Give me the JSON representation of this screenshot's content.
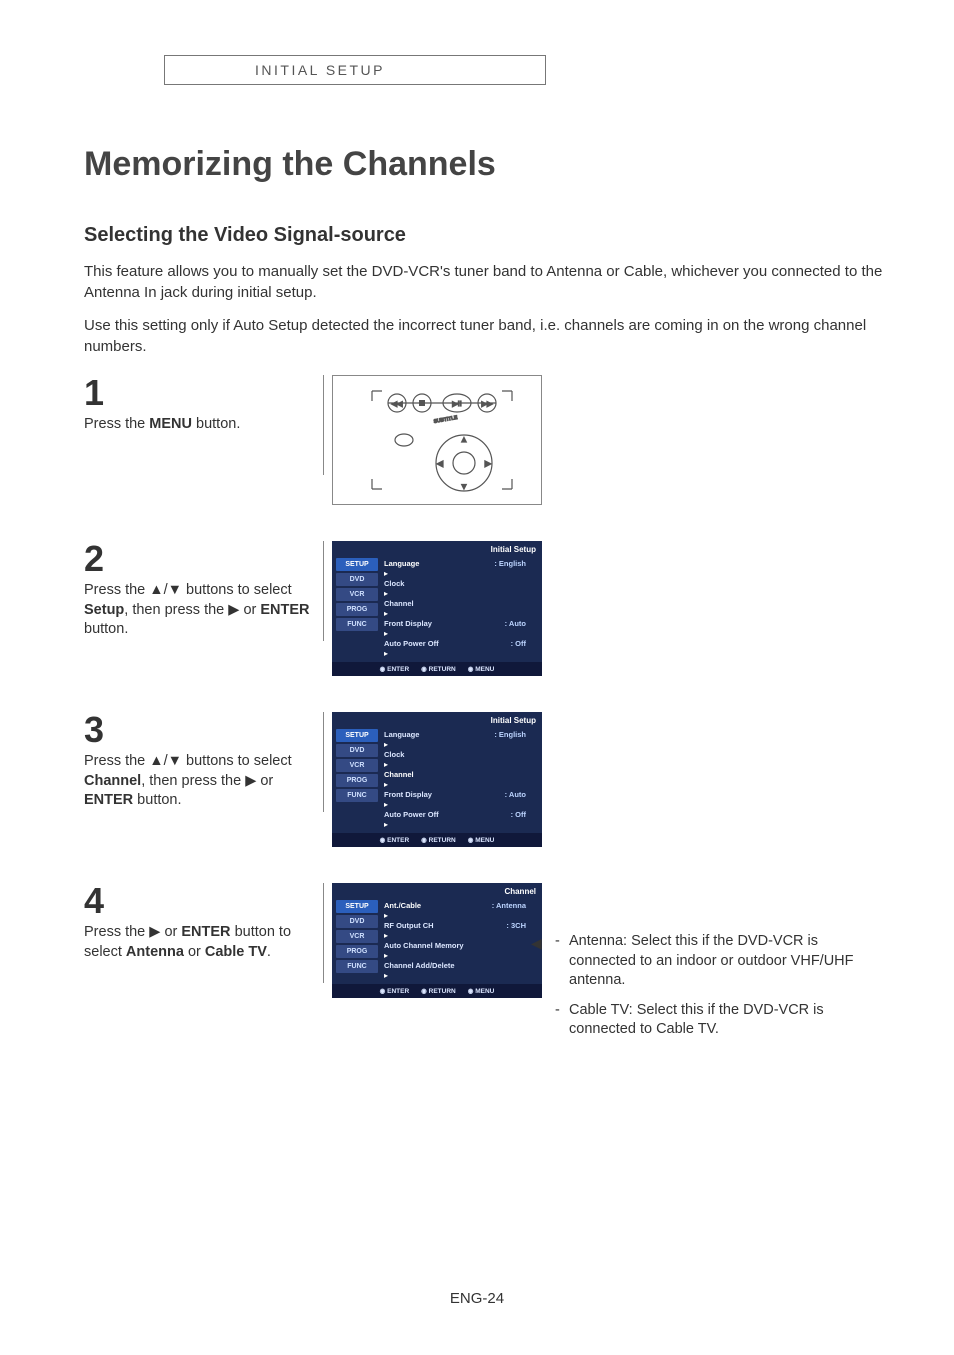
{
  "header": {
    "section": "INITIAL SETUP"
  },
  "title": "Memorizing the Channels",
  "subtitle": "Selecting the Video Signal-source",
  "intro1": "This feature allows you to manually set the DVD-VCR's tuner band to Antenna or Cable, whichever you connected to the Antenna In jack during initial setup.",
  "intro2": "Use this setting only if Auto Setup detected the incorrect tuner band, i.e. channels are coming in on the wrong channel numbers.",
  "steps": {
    "s1": {
      "num": "1",
      "pre": "Press the ",
      "bold": "MENU",
      "post": " button."
    },
    "s2": {
      "num": "2",
      "line1a": "Press the ",
      "line1b": "▲/▼",
      "line1c": " buttons to select ",
      "bold": "Setup",
      "line2a": ", then press the ",
      "arrow": "▶",
      "line2b": " or ",
      "bold2": "ENTER",
      "line2c": " button."
    },
    "s3": {
      "num": "3",
      "line1a": "Press the ",
      "line1b": "▲/▼",
      "line1c": " buttons to select ",
      "bold": "Channel",
      "line2a": ", then press the ",
      "arrow": "▶",
      "line2b": " or ",
      "bold2": "ENTER",
      "line2c": " button."
    },
    "s4": {
      "num": "4",
      "line1a": "Press the ",
      "arrow": "▶",
      "line1b": " or ",
      "bold1": "ENTER",
      "line1c": " button to select ",
      "bold2": "Antenna",
      "line1d": " or ",
      "bold3": "Cable TV",
      "line1e": "."
    }
  },
  "osd": {
    "initial_title": "Initial Setup",
    "channel_title": "Channel",
    "tabs": [
      "SETUP",
      "DVD",
      "VCR",
      "PROG",
      "FUNC"
    ],
    "setup_items": [
      {
        "label": "Language",
        "value": ": English"
      },
      {
        "label": "Clock",
        "value": ""
      },
      {
        "label": "Channel",
        "value": ""
      },
      {
        "label": "Front Display",
        "value": ": Auto"
      },
      {
        "label": "Auto Power Off",
        "value": ": Off"
      }
    ],
    "channel_items": [
      {
        "label": "Ant./Cable",
        "value": ": Antenna"
      },
      {
        "label": "RF Output CH",
        "value": ": 3CH"
      },
      {
        "label": "Auto Channel Memory",
        "value": ""
      },
      {
        "label": "Channel Add/Delete",
        "value": ""
      }
    ],
    "footer": {
      "enter": "ENTER",
      "return": "RETURN",
      "menu": "MENU"
    }
  },
  "notes": {
    "n1": "Antenna: Select this if the DVD-VCR is connected to an indoor or outdoor VHF/UHF antenna.",
    "n2": "Cable TV: Select this if the DVD-VCR is connected to Cable TV."
  },
  "footer": "ENG-24"
}
